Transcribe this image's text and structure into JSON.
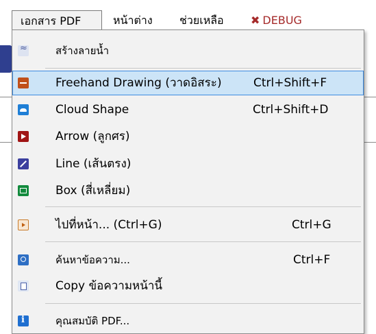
{
  "menubar": {
    "items": [
      {
        "label": "เอกสาร PDF",
        "active": true
      },
      {
        "label": "หน้าต่าง"
      },
      {
        "label": "ช่วยเหลือ"
      },
      {
        "label": "DEBUG",
        "icon": "tools-icon",
        "color": "#a52a2a"
      }
    ]
  },
  "menu": {
    "items": [
      {
        "label": "สร้างลายน้ำ",
        "icon": "watermark-icon"
      },
      {
        "label": "Freehand Drawing (วาดอิสระ)",
        "shortcut": "Ctrl+Shift+F",
        "icon": "freehand-icon",
        "highlighted": true
      },
      {
        "label": "Cloud Shape",
        "shortcut": "Ctrl+Shift+D",
        "icon": "cloud-icon"
      },
      {
        "label": "Arrow (ลูกศร)",
        "icon": "arrow-icon"
      },
      {
        "label": "Line (เส้นตรง)",
        "icon": "line-icon"
      },
      {
        "label": "Box (สี่เหลี่ยม)",
        "icon": "box-icon"
      },
      {
        "label": "ไปที่หน้า... (Ctrl+G)",
        "shortcut": "Ctrl+G",
        "icon": "goto-page-icon"
      },
      {
        "label": "ค้นหาข้อความ...",
        "shortcut": "Ctrl+F",
        "icon": "search-icon"
      },
      {
        "label": "Copy ข้อความหน้านี้",
        "icon": "copy-icon"
      },
      {
        "label": "คุณสมบัติ PDF...",
        "icon": "info-icon"
      }
    ]
  },
  "colors": {
    "highlight_bg": "#cce4f7",
    "highlight_border": "#3c8be0",
    "menu_bg": "#f2f2f2",
    "debug": "#a52a2a"
  }
}
